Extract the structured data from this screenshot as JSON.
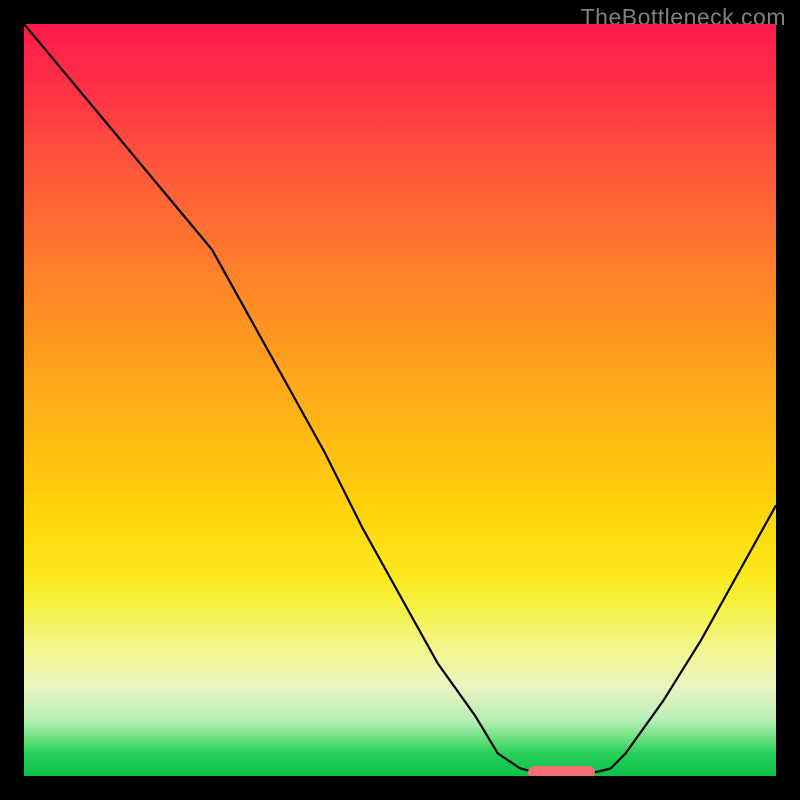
{
  "watermark_text": "TheBottleneck.com",
  "colors": {
    "background": "#000000",
    "watermark": "#808080",
    "curve": "#000000",
    "marker": "#f47070"
  },
  "chart_data": {
    "type": "line",
    "title": "",
    "xlabel": "",
    "ylabel": "",
    "xlim": [
      0,
      100
    ],
    "ylim": [
      0,
      100
    ],
    "x": [
      0,
      5,
      10,
      15,
      20,
      25,
      30,
      35,
      40,
      45,
      50,
      55,
      60,
      63,
      66,
      70,
      74,
      78,
      80,
      85,
      90,
      95,
      100
    ],
    "y": [
      100,
      94,
      88,
      82,
      76,
      70,
      61,
      52,
      43,
      33,
      24,
      15,
      8,
      3,
      1,
      0,
      0,
      1,
      3,
      10,
      18,
      27,
      36
    ],
    "marker_segment": {
      "x_start": 67,
      "x_end": 76,
      "y": 0
    },
    "annotations": []
  }
}
